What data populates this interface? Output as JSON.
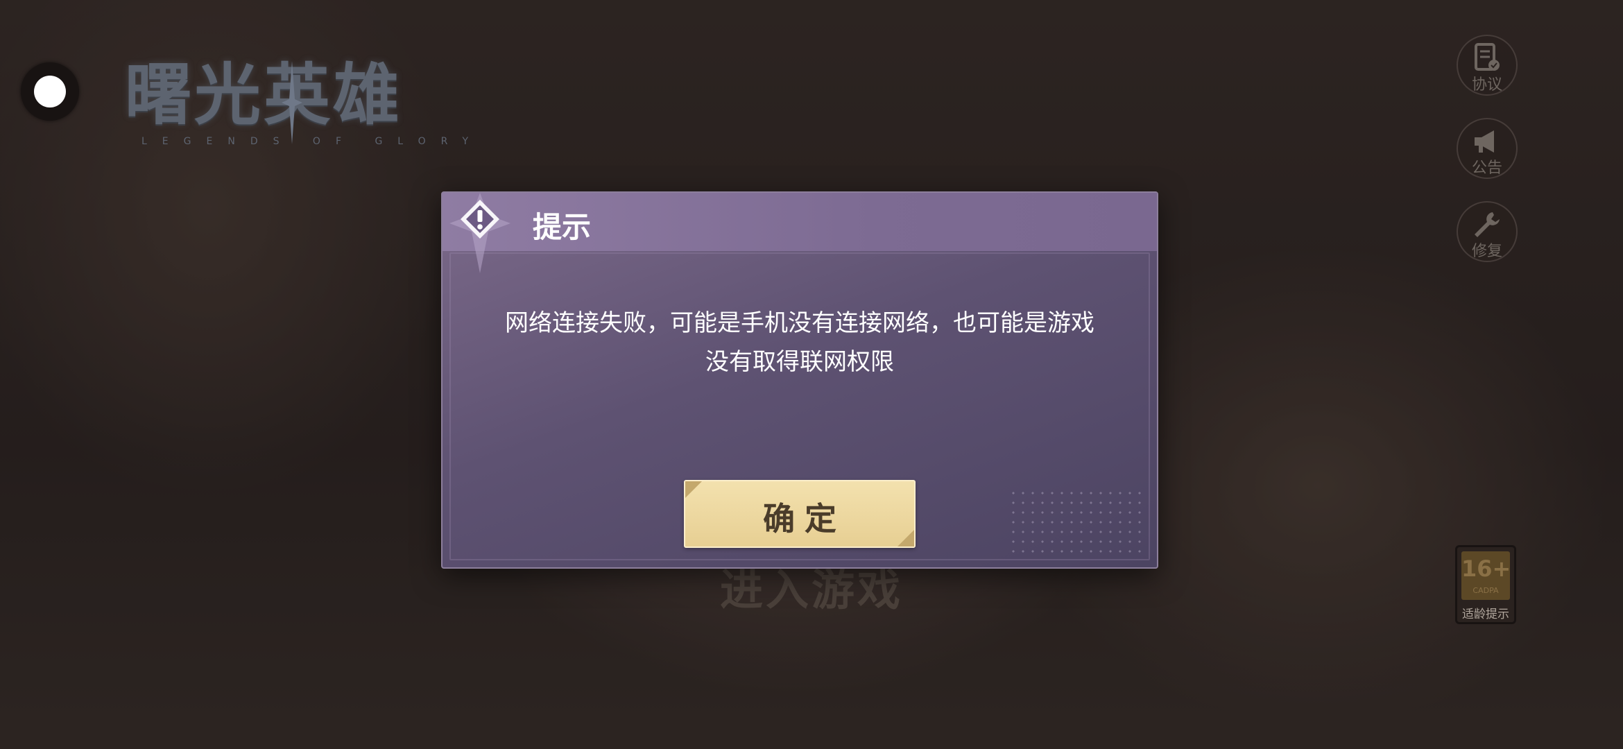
{
  "logo": {
    "title": "曙光英雄",
    "subtitle": "LEGENDS OF GLORY"
  },
  "side_buttons": [
    {
      "icon": "agreement-icon",
      "label": "协议"
    },
    {
      "icon": "megaphone-icon",
      "label": "公告"
    },
    {
      "icon": "wrench-icon",
      "label": "修复"
    }
  ],
  "age_rating": {
    "value": "16+",
    "org": "CADPA",
    "label": "适龄提示"
  },
  "enter_game": {
    "label": "进入游戏"
  },
  "dialog": {
    "title": "提示",
    "icon": "warning-icon",
    "message": "网络连接失败，可能是手机没有连接网络，也可能是游戏没有取得联网权限",
    "confirm_label": "确定"
  },
  "colors": {
    "dialog_bg": "#5e5272",
    "button_bg": "#ecd69f",
    "button_text": "#4a3c2a"
  }
}
